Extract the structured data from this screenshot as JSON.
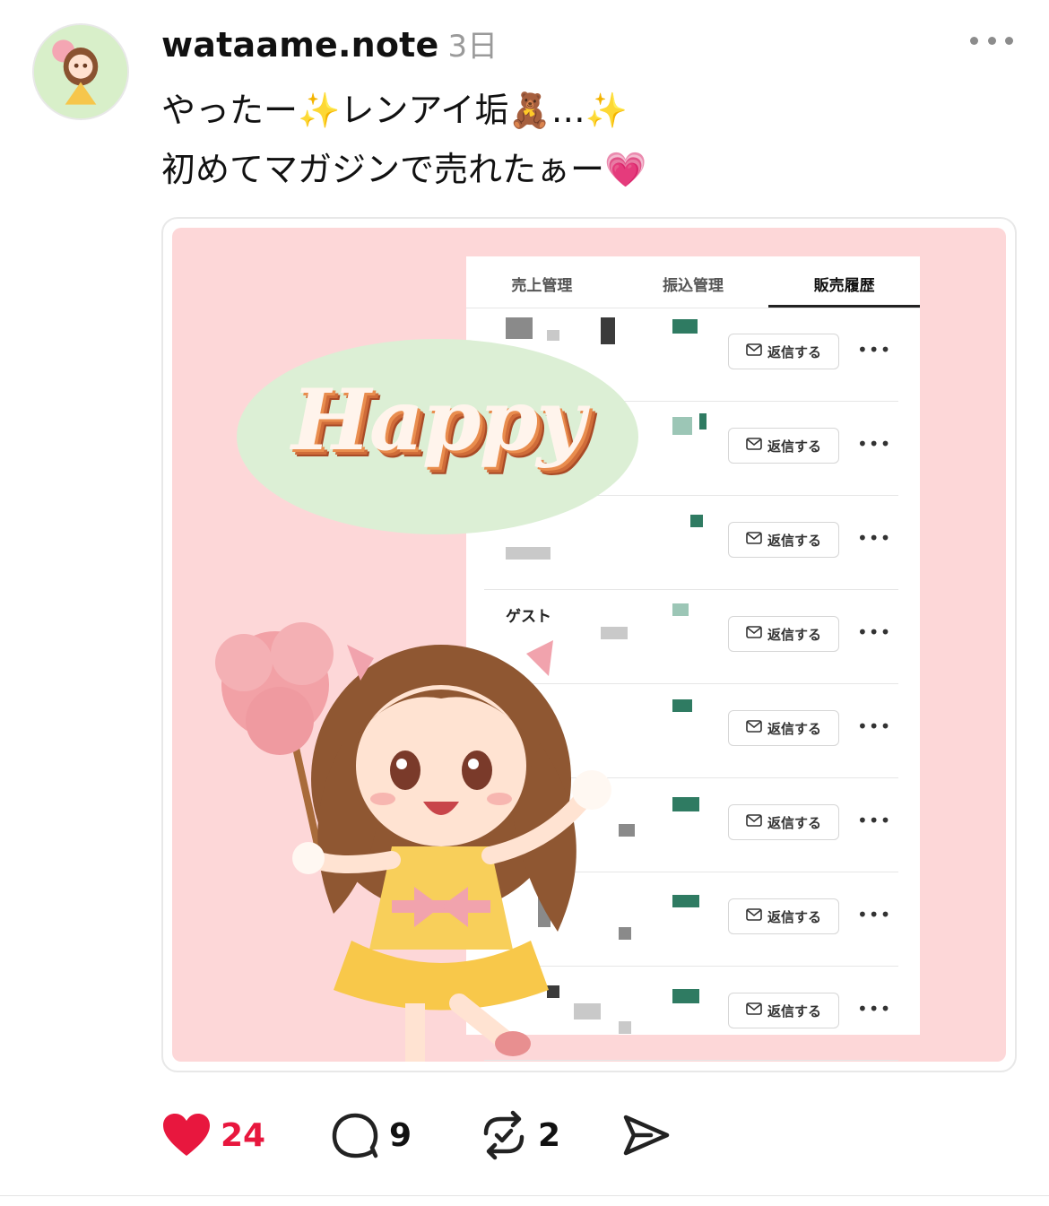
{
  "post": {
    "username": "wataame.note",
    "time": "3日",
    "line1": "やったー✨レンアイ垢🧸…✨",
    "line2": "初めてマガジンで売れたぁー💗",
    "image": {
      "overlay_text": "Happy",
      "tabs": [
        "売上管理",
        "振込管理",
        "販売履歴"
      ],
      "active_tab": 2,
      "row_names": [
        "",
        "",
        "",
        "ゲスト",
        "",
        "",
        "",
        ""
      ],
      "reply_label": "返信する",
      "row_more": "•••"
    },
    "actions": {
      "likes": "24",
      "comments": "9",
      "reposts": "2"
    }
  },
  "colors": {
    "like": "#e8173e",
    "image_bg": "#fdd7d8",
    "blob": "#dcefd5"
  },
  "icons": [
    "more-icon",
    "heart-icon",
    "comment-icon",
    "repost-icon",
    "share-icon",
    "mail-icon"
  ]
}
